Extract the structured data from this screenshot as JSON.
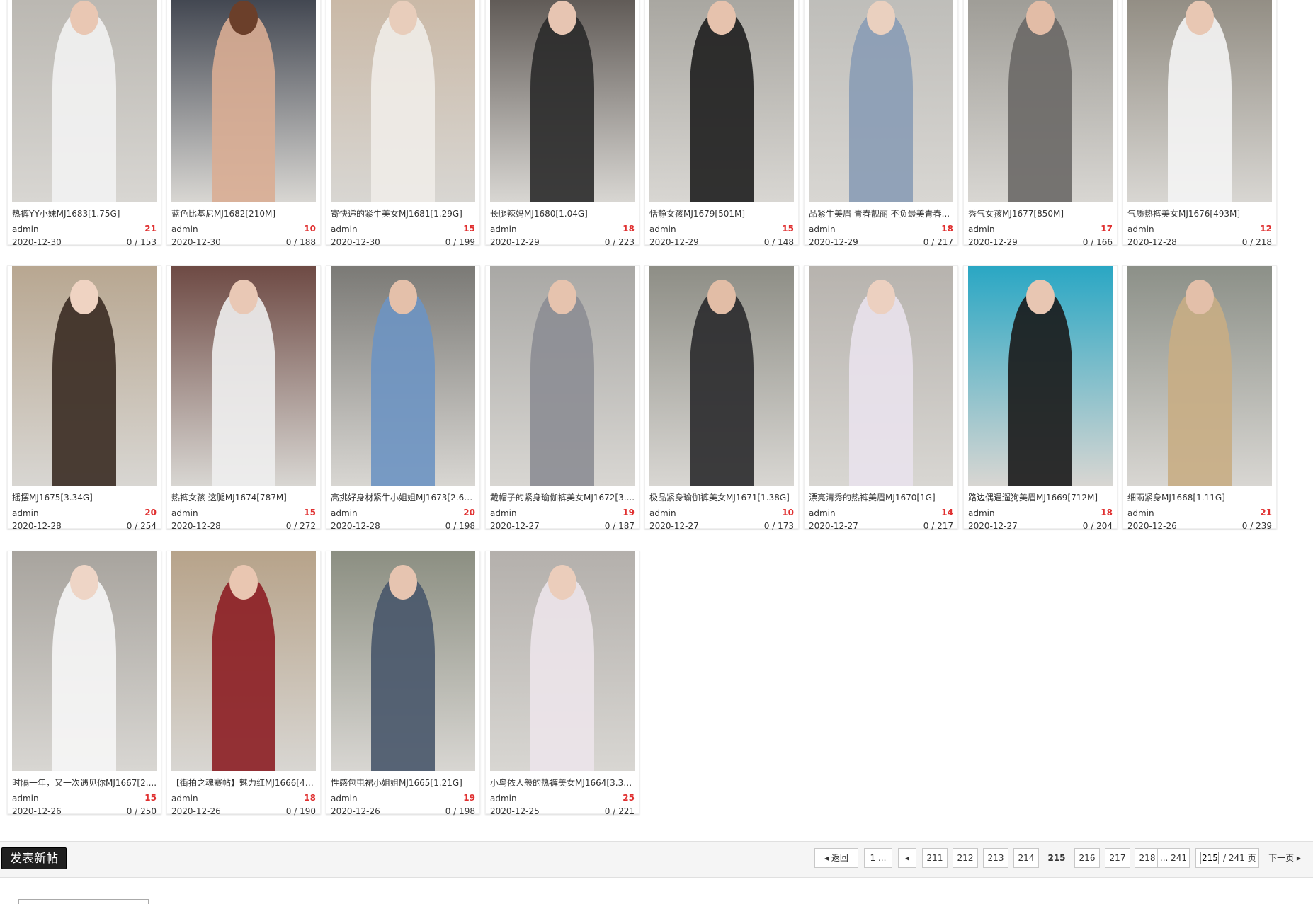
{
  "posts": [
    {
      "title": "热裤YY小妹MJ1683[1.75G]",
      "author": "admin",
      "heat": "21",
      "date": "2020-12-30",
      "stats": "0 / 153",
      "bg": "#b9b6b0",
      "fg": "#f2f2f2",
      "skin": "#e9c7b3"
    },
    {
      "title": "蓝色比基尼MJ1682[210M]",
      "author": "admin",
      "heat": "10",
      "date": "2020-12-30",
      "stats": "0 / 188",
      "bg": "#3a3f4a",
      "fg": "#d9ad93",
      "skin": "#6b3f2a"
    },
    {
      "title": "寄快递的紧牛美女MJ1681[1.29G]",
      "author": "admin",
      "heat": "15",
      "date": "2020-12-30",
      "stats": "0 / 199",
      "bg": "#c9b7a4",
      "fg": "#f0ece8",
      "skin": "#e8cdbb"
    },
    {
      "title": "长腿辣妈MJ1680[1.04G]",
      "author": "admin",
      "heat": "18",
      "date": "2020-12-29",
      "stats": "0 / 223",
      "bg": "#5a5450",
      "fg": "#2a2a2a",
      "skin": "#e7c5b2"
    },
    {
      "title": "恬静女孩MJ1679[501M]",
      "author": "admin",
      "heat": "15",
      "date": "2020-12-29",
      "stats": "0 / 148",
      "bg": "#a6a49e",
      "fg": "#1e1e1e",
      "skin": "#e6c2ad"
    },
    {
      "title": "品紧牛美眉 青春靓丽 不负最美青春...",
      "author": "admin",
      "heat": "18",
      "date": "2020-12-29",
      "stats": "0 / 217",
      "bg": "#bdbcb8",
      "fg": "#8a9cb5",
      "skin": "#ead0bf"
    },
    {
      "title": "秀气女孩MJ1677[850M]",
      "author": "admin",
      "heat": "17",
      "date": "2020-12-29",
      "stats": "0 / 166",
      "bg": "#9c9a94",
      "fg": "#6a6866",
      "skin": "#e2bca6"
    },
    {
      "title": "气质热裤美女MJ1676[493M]",
      "author": "admin",
      "heat": "12",
      "date": "2020-12-28",
      "stats": "0 / 218",
      "bg": "#8f8a80",
      "fg": "#f4f4f4",
      "skin": "#e8c7b3"
    },
    {
      "title": "摇摆MJ1675[3.34G]",
      "author": "admin",
      "heat": "20",
      "date": "2020-12-28",
      "stats": "0 / 254",
      "bg": "#b8a791",
      "fg": "#3a2b22",
      "skin": "#efd3c2"
    },
    {
      "title": "热裤女孩 这腿MJ1674[787M]",
      "author": "admin",
      "heat": "15",
      "date": "2020-12-28",
      "stats": "0 / 272",
      "bg": "#6e4a44",
      "fg": "#eeeeee",
      "skin": "#e9c8b5"
    },
    {
      "title": "高挑好身材紧牛小姐姐MJ1673[2.69...",
      "author": "admin",
      "heat": "20",
      "date": "2020-12-28",
      "stats": "0 / 198",
      "bg": "#7b7a76",
      "fg": "#6d94c2",
      "skin": "#e4c0aa"
    },
    {
      "title": "戴帽子的紧身瑜伽裤美女MJ1672[3....",
      "author": "admin",
      "heat": "19",
      "date": "2020-12-27",
      "stats": "0 / 187",
      "bg": "#a9a8a5",
      "fg": "#8c8d93",
      "skin": "#e6c3ae"
    },
    {
      "title": "极品紧身瑜伽裤美女MJ1671[1.38G]",
      "author": "admin",
      "heat": "10",
      "date": "2020-12-27",
      "stats": "0 / 173",
      "bg": "#8e8e86",
      "fg": "#2a2a2c",
      "skin": "#e2bda6"
    },
    {
      "title": "漂亮清秀的热裤美眉MJ1670[1G]",
      "author": "admin",
      "heat": "14",
      "date": "2020-12-27",
      "stats": "0 / 217",
      "bg": "#b7b3ae",
      "fg": "#e9e2ec",
      "skin": "#ecd0c0"
    },
    {
      "title": "路边偶遇遛狗美眉MJ1669[712M]",
      "author": "admin",
      "heat": "18",
      "date": "2020-12-27",
      "stats": "0 / 204",
      "bg": "#2aa7c4",
      "fg": "#1a1a1a",
      "skin": "#e8c6b2"
    },
    {
      "title": "细雨紧身MJ1668[1.11G]",
      "author": "admin",
      "heat": "21",
      "date": "2020-12-26",
      "stats": "0 / 239",
      "bg": "#8c9088",
      "fg": "#c8ad84",
      "skin": "#e3bfa9"
    },
    {
      "title": "时隔一年，又一次遇见你MJ1667[2....",
      "author": "admin",
      "heat": "15",
      "date": "2020-12-26",
      "stats": "0 / 250",
      "bg": "#a8a49e",
      "fg": "#f6f6f6",
      "skin": "#eed5c6"
    },
    {
      "title": "【街拍之魂赛帖】魅力红MJ1666[45...",
      "author": "admin",
      "heat": "18",
      "date": "2020-12-26",
      "stats": "0 / 190",
      "bg": "#b7a38a",
      "fg": "#8c1e24",
      "skin": "#e9c6b1"
    },
    {
      "title": "性感包屯裙小姐姐MJ1665[1.21G]",
      "author": "admin",
      "heat": "19",
      "date": "2020-12-26",
      "stats": "0 / 198",
      "bg": "#8c8f82",
      "fg": "#48566a",
      "skin": "#e6c4b0"
    },
    {
      "title": "小鸟依人般的热裤美女MJ1664[3.39...",
      "author": "admin",
      "heat": "25",
      "date": "2020-12-25",
      "stats": "0 / 221",
      "bg": "#b4b0ac",
      "fg": "#ece4ea",
      "skin": "#ebcdbb"
    }
  ],
  "toolbar": {
    "new_post_label": "发表新帖"
  },
  "pagination": {
    "back_label": "返回",
    "first_label": "1 ...",
    "prev_icon": "caret-left-icon",
    "pages": [
      "211",
      "212",
      "213",
      "214",
      "215",
      "216",
      "217",
      "218"
    ],
    "current_page": "215",
    "last_label": "... 241",
    "page_input_value": "215",
    "total_label": "/ 241 页",
    "next_label": "下一页"
  }
}
